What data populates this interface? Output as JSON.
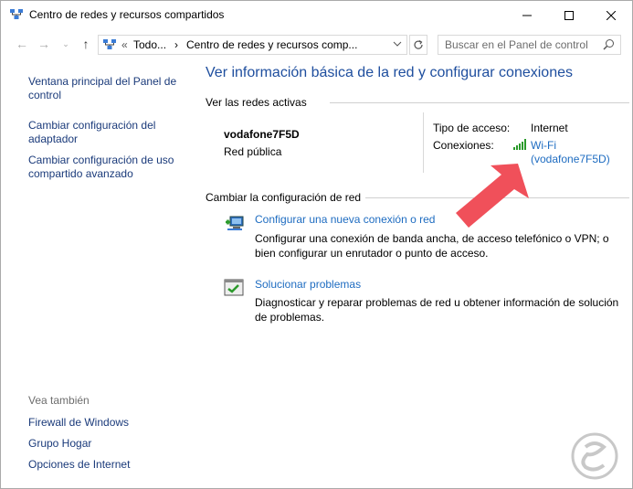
{
  "window": {
    "title": "Centro de redes y recursos compartidos",
    "minimize_icon": "minimize-icon",
    "maximize_icon": "maximize-icon",
    "close_icon": "close-icon"
  },
  "navbar": {
    "breadcrumb": [
      "«",
      "Todo...",
      "›",
      "Centro de redes y recursos comp..."
    ],
    "search_placeholder": "Buscar en el Panel de control"
  },
  "left_pane": {
    "links": [
      "Ventana principal del Panel de control",
      "Cambiar configuración del adaptador",
      "Cambiar configuración de uso compartido avanzado"
    ],
    "see_also_title": "Vea también",
    "see_also_links": [
      "Firewall de Windows",
      "Grupo Hogar",
      "Opciones de Internet"
    ]
  },
  "main": {
    "title": "Ver información básica de la red y configurar conexiones",
    "active_networks_header": "Ver las redes activas",
    "network": {
      "name": "vodafone7F5D",
      "type": "Red pública",
      "access_type_label": "Tipo de acceso:",
      "access_type_value": "Internet",
      "connections_label": "Conexiones:",
      "connection_link_line1": "Wi-Fi",
      "connection_link_line2": "(vodafone7F5D)"
    },
    "change_settings_header": "Cambiar la configuración de red",
    "tasks": [
      {
        "link": "Configurar una nueva conexión o red",
        "description": "Configurar una conexión de banda ancha, de acceso telefónico o VPN; o bien configurar un enrutador o punto de acceso."
      },
      {
        "link": "Solucionar problemas",
        "description": "Diagnosticar y reparar problemas de red u obtener información de solución de problemas."
      }
    ]
  },
  "colors": {
    "link": "#1e6cc1",
    "title": "#1e4e9e",
    "arrow": "#f0505a"
  }
}
